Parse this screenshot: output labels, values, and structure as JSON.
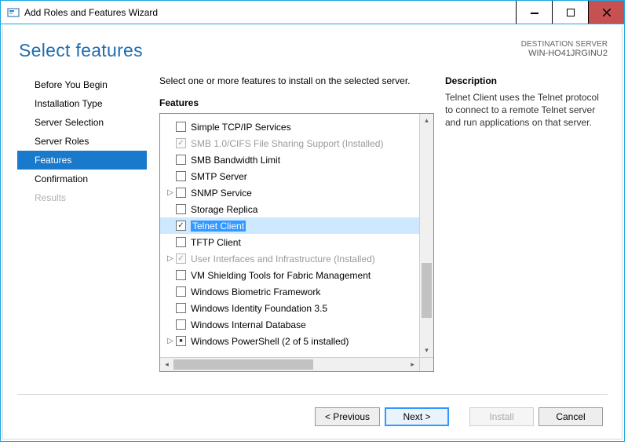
{
  "window": {
    "title": "Add Roles and Features Wizard"
  },
  "header": {
    "page_title": "Select features",
    "dest_label": "DESTINATION SERVER",
    "dest_value": "WIN-HO41JRGINU2"
  },
  "sidebar": {
    "steps": [
      {
        "label": "Before You Begin",
        "state": "normal"
      },
      {
        "label": "Installation Type",
        "state": "normal"
      },
      {
        "label": "Server Selection",
        "state": "normal"
      },
      {
        "label": "Server Roles",
        "state": "normal"
      },
      {
        "label": "Features",
        "state": "selected"
      },
      {
        "label": "Confirmation",
        "state": "normal"
      },
      {
        "label": "Results",
        "state": "disabled"
      }
    ]
  },
  "main": {
    "intro": "Select one or more features to install on the selected server.",
    "list_label": "Features",
    "items": [
      {
        "label": "Simple TCP/IP Services",
        "checked": "",
        "expander": "",
        "disabled": false,
        "selected": false
      },
      {
        "label": "SMB 1.0/CIFS File Sharing Support (Installed)",
        "checked": "checked",
        "expander": "",
        "disabled": true,
        "selected": false
      },
      {
        "label": "SMB Bandwidth Limit",
        "checked": "",
        "expander": "",
        "disabled": false,
        "selected": false
      },
      {
        "label": "SMTP Server",
        "checked": "",
        "expander": "",
        "disabled": false,
        "selected": false
      },
      {
        "label": "SNMP Service",
        "checked": "",
        "expander": "▷",
        "disabled": false,
        "selected": false
      },
      {
        "label": "Storage Replica",
        "checked": "",
        "expander": "",
        "disabled": false,
        "selected": false
      },
      {
        "label": "Telnet Client",
        "checked": "checked",
        "expander": "",
        "disabled": false,
        "selected": true
      },
      {
        "label": "TFTP Client",
        "checked": "",
        "expander": "",
        "disabled": false,
        "selected": false
      },
      {
        "label": "User Interfaces and Infrastructure (Installed)",
        "checked": "checked",
        "expander": "▷",
        "disabled": true,
        "selected": false
      },
      {
        "label": "VM Shielding Tools for Fabric Management",
        "checked": "",
        "expander": "",
        "disabled": false,
        "selected": false
      },
      {
        "label": "Windows Biometric Framework",
        "checked": "",
        "expander": "",
        "disabled": false,
        "selected": false
      },
      {
        "label": "Windows Identity Foundation 3.5",
        "checked": "",
        "expander": "",
        "disabled": false,
        "selected": false
      },
      {
        "label": "Windows Internal Database",
        "checked": "",
        "expander": "",
        "disabled": false,
        "selected": false
      },
      {
        "label": "Windows PowerShell (2 of 5 installed)",
        "checked": "partial",
        "expander": "▷",
        "disabled": false,
        "selected": false
      }
    ],
    "desc_heading": "Description",
    "desc_text": "Telnet Client uses the Telnet protocol to connect to a remote Telnet server and run applications on that server."
  },
  "footer": {
    "previous": "< Previous",
    "next": "Next >",
    "install": "Install",
    "cancel": "Cancel"
  }
}
